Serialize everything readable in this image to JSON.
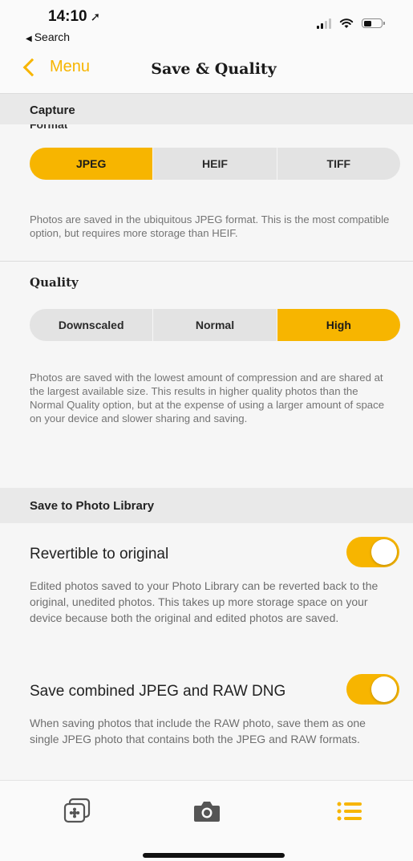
{
  "status": {
    "time": "14:10",
    "back_app": "Search"
  },
  "nav": {
    "back_label": "Menu",
    "title": "Save & Quality"
  },
  "capture": {
    "header": "Capture",
    "sub_header": "Format",
    "format_options": [
      "JPEG",
      "HEIF",
      "TIFF"
    ],
    "format_selected": "JPEG",
    "format_description": "Photos are saved in the ubiquitous JPEG format. This is the most compatible option, but requires more storage than HEIF.",
    "quality_label": "Quality",
    "quality_options": [
      "Downscaled",
      "Normal",
      "High"
    ],
    "quality_selected": "High",
    "quality_description": "Photos are saved with the lowest amount of compression and are shared at the largest available size. This results in higher quality photos than the Normal Quality option, but at the expense of using a larger amount of space on your device and slower sharing and saving."
  },
  "library": {
    "header": "Save to Photo Library",
    "revertible": {
      "label": "Revertible to original",
      "on": true,
      "description": "Edited photos saved to your Photo Library can be reverted back to the original, unedited photos. This takes up more storage space on your device because both the original and edited photos are saved."
    },
    "combined": {
      "label": "Save combined JPEG and RAW DNG",
      "on": true,
      "description": "When saving photos that include the RAW photo, save them as one single JPEG photo that contains both the JPEG and RAW formats."
    }
  },
  "tabs": [
    "gallery-icon",
    "camera-icon",
    "menu-list-icon"
  ],
  "active_tab": "menu-list-icon",
  "colors": {
    "accent": "#f7b500",
    "header_bg": "#e9e9e9",
    "inactive_icon": "#555555"
  }
}
